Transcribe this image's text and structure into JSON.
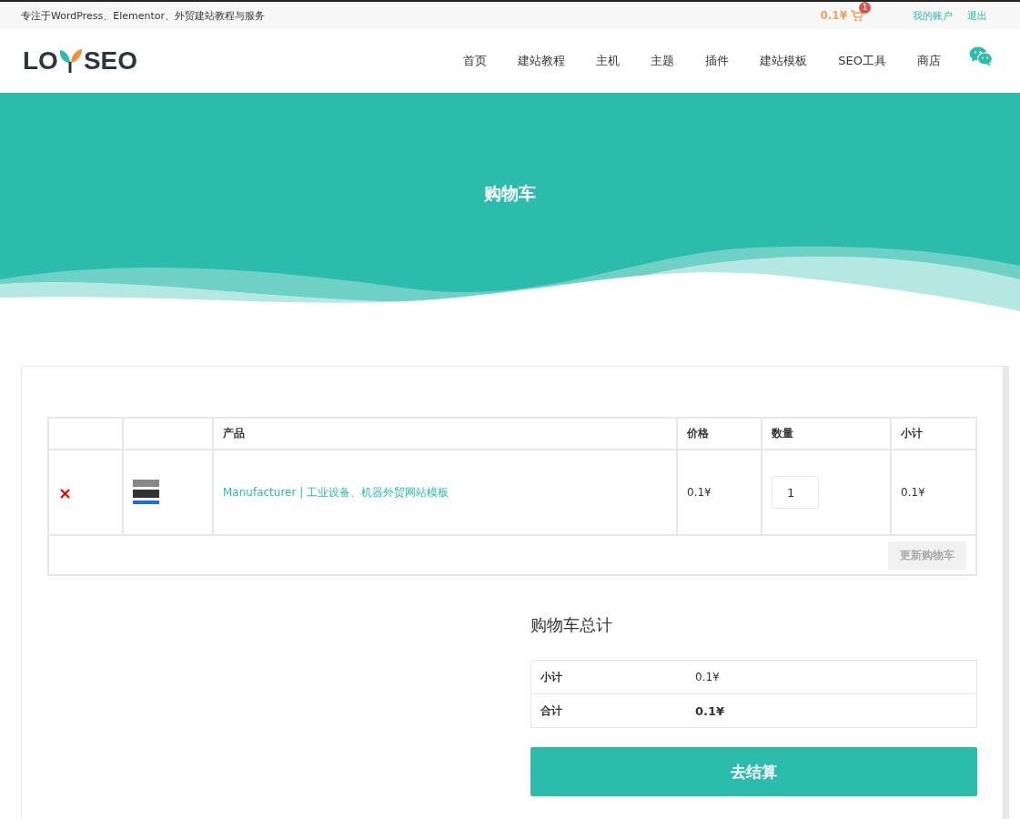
{
  "topbar": {
    "tagline": "专注于WordPress、Elementor、外贸建站教程与服务",
    "cart_total": "0.1¥",
    "cart_count": "1",
    "links": [
      "我的账户",
      "退出"
    ]
  },
  "header": {
    "logo": {
      "left": "LO",
      "right": "SEO"
    },
    "nav": [
      "首页",
      "建站教程",
      "主机",
      "主题",
      "插件",
      "建站模板",
      "SEO工具",
      "商店"
    ]
  },
  "hero": {
    "title": "购物车"
  },
  "cart": {
    "columns": [
      "",
      "",
      "产品",
      "价格",
      "数量",
      "小计"
    ],
    "rows": [
      {
        "remove": "×",
        "product": "Manufacturer | 工业设备、机器外贸网站模板",
        "price": "0.1¥",
        "quantity": "1",
        "subtotal": "0.1¥"
      }
    ],
    "update_button": {
      "label": "更新购物车",
      "disabled": true
    }
  },
  "totals": {
    "title": "购物车总计",
    "rows": [
      {
        "label": "小计",
        "value": "0.1¥",
        "bold": false
      },
      {
        "label": "合计",
        "value": "0.1¥",
        "bold": true
      }
    ],
    "checkout": "去结算"
  }
}
